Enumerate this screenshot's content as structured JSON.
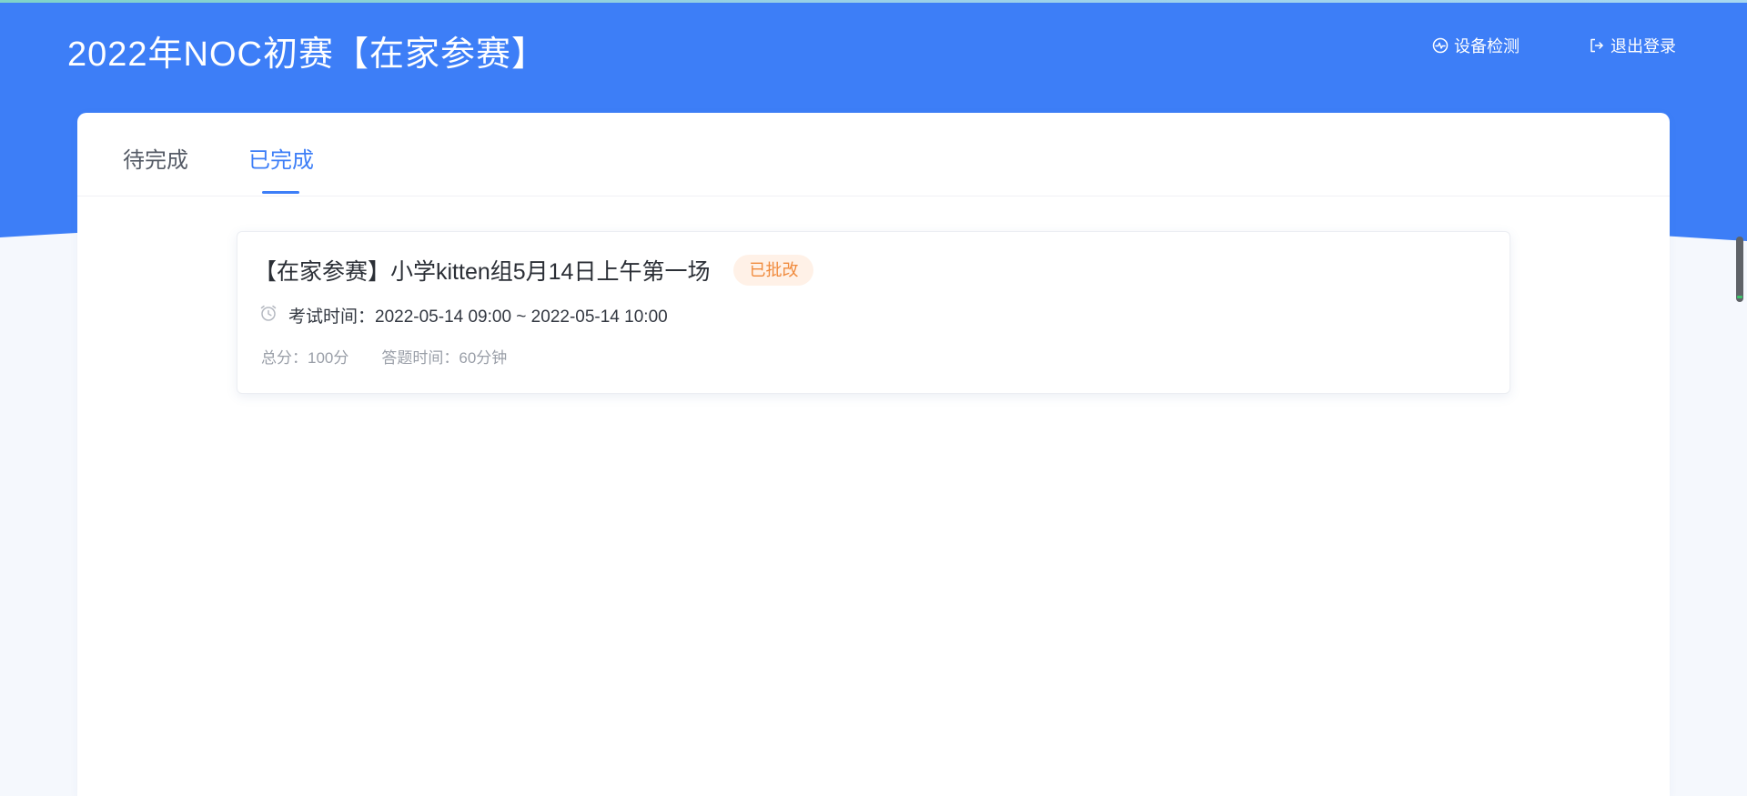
{
  "header": {
    "title": "2022年NOC初赛【在家参赛】",
    "device_check_label": "设备检测",
    "logout_label": "退出登录",
    "background_color": "#3d7ef7",
    "text_color": "#ffffff"
  },
  "tabs": [
    {
      "label": "待完成",
      "active": false
    },
    {
      "label": "已完成",
      "active": true
    }
  ],
  "exam_list": [
    {
      "title": "【在家参赛】小学kitten组5月14日上午第一场",
      "status": "已批改",
      "time_label": "考试时间：",
      "time_value": "2022-05-14 09:00 ~ 2022-05-14 10:00",
      "total_score_label": "总分：100分",
      "duration_label": "答题时间：60分钟"
    }
  ],
  "colors": {
    "accent": "#3d7ef7",
    "status_badge_text": "#f08a3c",
    "status_badge_bg": "#fff1e7",
    "page_bg": "#f5f8fd"
  },
  "icons": {
    "device_check": "pulse-circle-icon",
    "logout": "logout-icon",
    "exam_time": "alarm-clock-icon"
  }
}
